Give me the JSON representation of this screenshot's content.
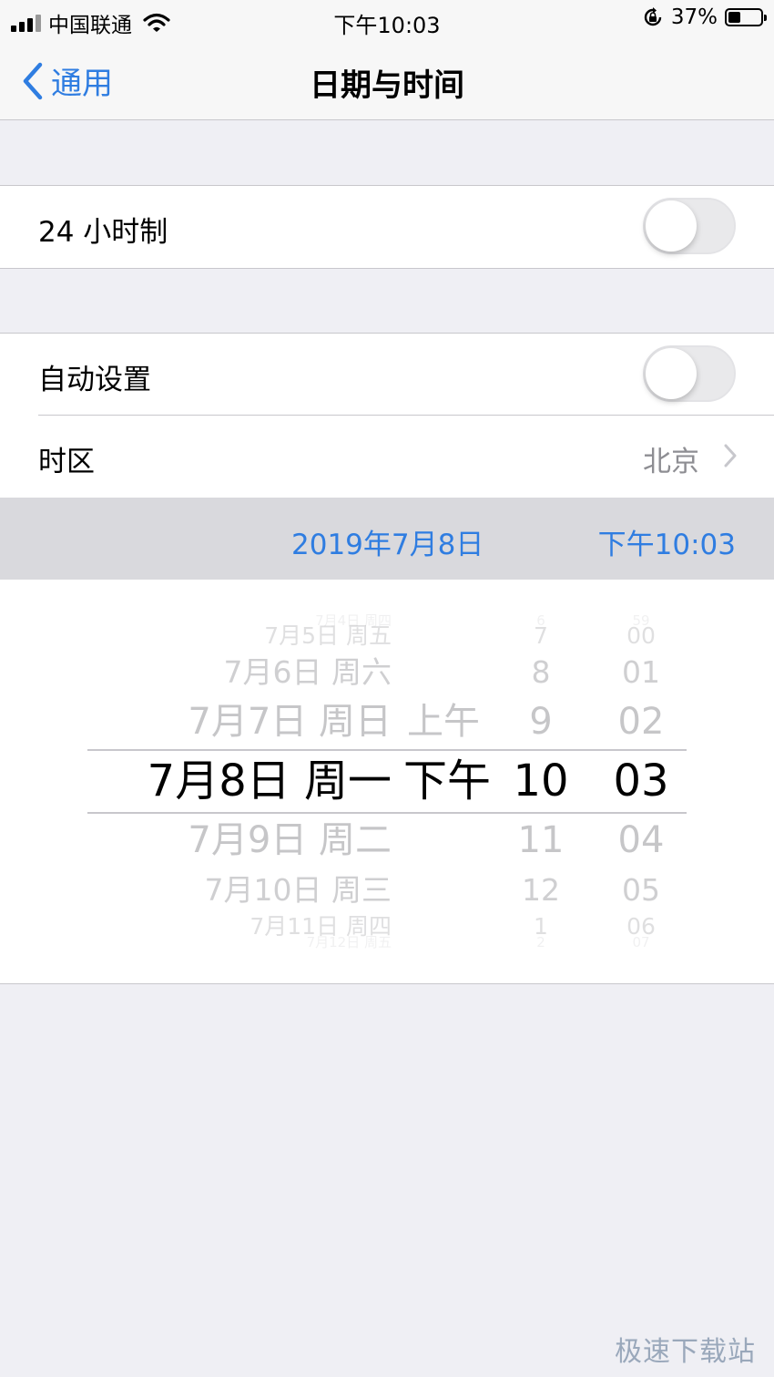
{
  "status_bar": {
    "carrier": "中国联通",
    "time": "下午10:03",
    "battery": "37%",
    "battery_level": 0.37
  },
  "nav": {
    "back_label": "通用",
    "title": "日期与时间"
  },
  "settings": {
    "hour24": {
      "label": "24 小时制",
      "on": false
    },
    "auto_set": {
      "label": "自动设置",
      "on": false
    },
    "timezone": {
      "label": "时区",
      "value": "北京"
    }
  },
  "selected": {
    "date": "2019年7月8日",
    "time": "下午10:03"
  },
  "picker": {
    "rows": [
      {
        "date": "7月4日 周四",
        "ampm": "",
        "hour": "6",
        "minute": "59"
      },
      {
        "date": "7月5日 周五",
        "ampm": "",
        "hour": "7",
        "minute": "00"
      },
      {
        "date": "7月6日 周六",
        "ampm": "",
        "hour": "8",
        "minute": "01"
      },
      {
        "date": "7月7日 周日",
        "ampm": "上午",
        "hour": "9",
        "minute": "02"
      },
      {
        "date": "7月8日 周一",
        "ampm": "下午",
        "hour": "10",
        "minute": "03"
      },
      {
        "date": "7月9日 周二",
        "ampm": "",
        "hour": "11",
        "minute": "04"
      },
      {
        "date": "7月10日 周三",
        "ampm": "",
        "hour": "12",
        "minute": "05"
      },
      {
        "date": "7月11日 周四",
        "ampm": "",
        "hour": "1",
        "minute": "06"
      },
      {
        "date": "7月12日 周五",
        "ampm": "",
        "hour": "2",
        "minute": "07"
      }
    ],
    "selected_index": 4
  },
  "watermark": "极速下载站",
  "colors": {
    "accent": "#2f7de1",
    "background": "#efeff4",
    "secondary_text": "#8e8e93"
  }
}
